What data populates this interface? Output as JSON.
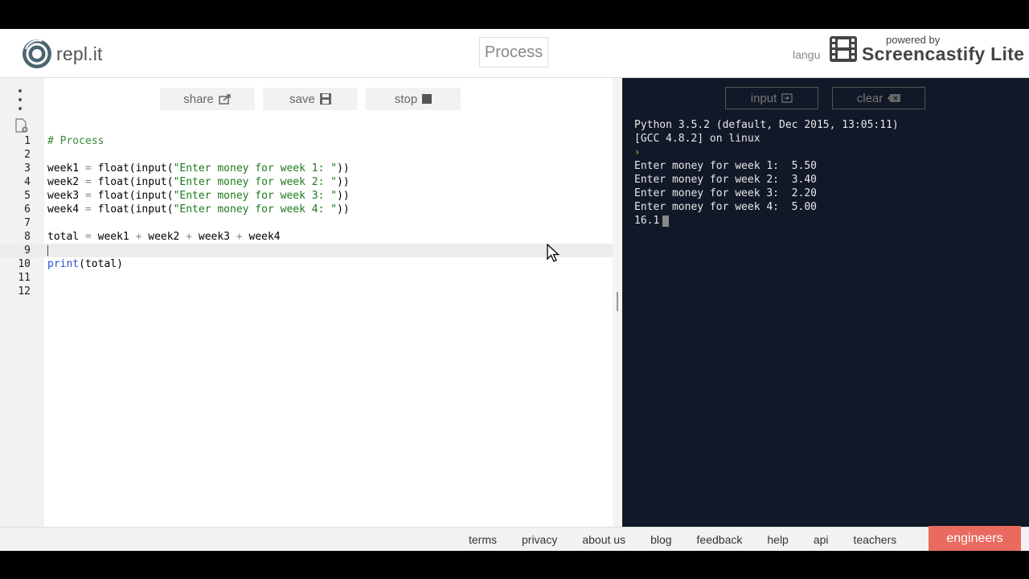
{
  "header": {
    "logo_text": "repl.it",
    "project_title": "Process",
    "language_label": "langu"
  },
  "watermark": {
    "powered_by": "powered by",
    "brand": "Screencastify Lite"
  },
  "toolbar": {
    "share_label": "share",
    "save_label": "save",
    "stop_label": "stop"
  },
  "editor": {
    "line_numbers": [
      "1",
      "2",
      "3",
      "4",
      "5",
      "6",
      "7",
      "8",
      "9",
      "10",
      "11",
      "12"
    ],
    "active_line": 9,
    "lines": {
      "l1_comment": "# Process",
      "l3_var": "week1",
      "l3_prompt": "\"Enter money for week 1: \"",
      "l4_var": "week2",
      "l4_prompt": "\"Enter money for week 2: \"",
      "l5_var": "week3",
      "l5_prompt": "\"Enter money for week 3: \"",
      "l6_var": "week4",
      "l6_prompt": "\"Enter money for week 4: \"",
      "eq": "=",
      "float_fn": "float",
      "input_fn": "input",
      "l8_total": "total",
      "l8_w1": "week1",
      "l8_w2": "week2",
      "l8_w3": "week3",
      "l8_w4": "week4",
      "plus": "+",
      "l10_print": "print",
      "l10_arg": "(total)"
    }
  },
  "console": {
    "input_label": "input",
    "clear_label": "clear",
    "banner_1": "Python 3.5.2 (default, Dec 2015, 13:05:11)",
    "banner_2": "[GCC 4.8.2] on linux",
    "prompt_symbol": "›",
    "output": [
      "Enter money for week 1:  5.50",
      "Enter money for week 2:  3.40",
      "Enter money for week 3:  2.20",
      "Enter money for week 4:  5.00"
    ],
    "result": "16.1"
  },
  "footer": {
    "links": [
      "terms",
      "privacy",
      "about us",
      "blog",
      "feedback",
      "help",
      "api",
      "teachers"
    ],
    "engineers_label": "engineers"
  },
  "colors": {
    "console_bg": "#111827",
    "accent": "#e96a5f",
    "comment": "#3a8a3a",
    "keyword": "#2a4fd0"
  }
}
